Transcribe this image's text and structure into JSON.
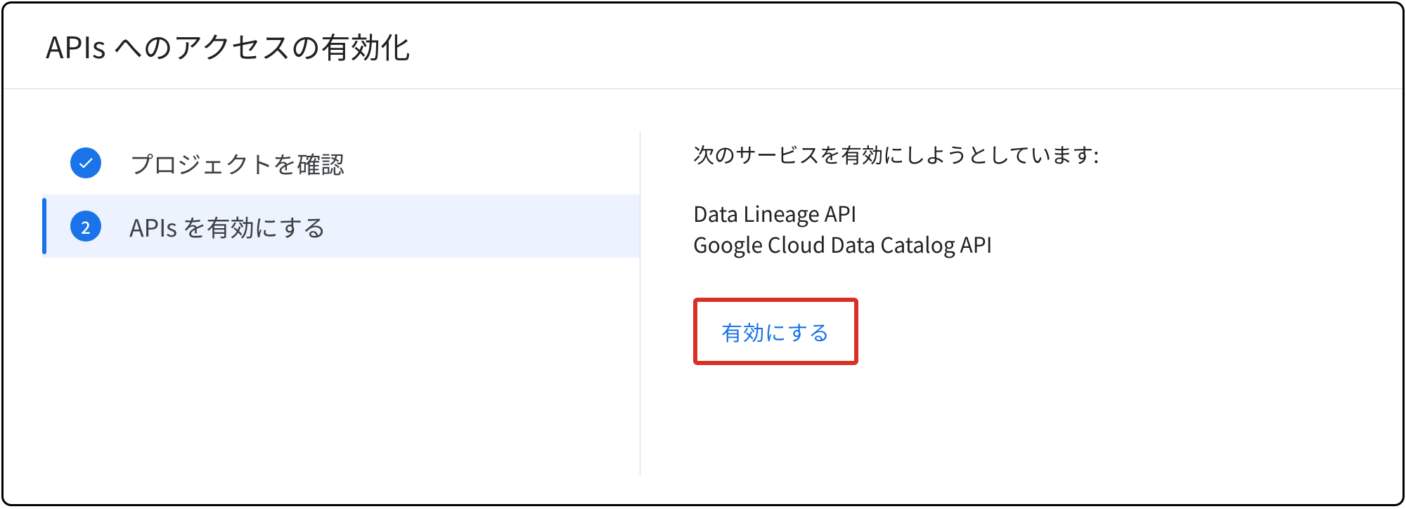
{
  "header": {
    "title": "APIs へのアクセスの有効化"
  },
  "steps": [
    {
      "label": "プロジェクトを確認",
      "completed": true
    },
    {
      "label": "APIs を有効にする",
      "number": "2",
      "active": true
    }
  ],
  "rightPanel": {
    "intro": "次のサービスを有効にしようとしています:",
    "apis": [
      "Data Lineage API",
      "Google Cloud Data Catalog API"
    ],
    "enableButton": "有効にする"
  }
}
